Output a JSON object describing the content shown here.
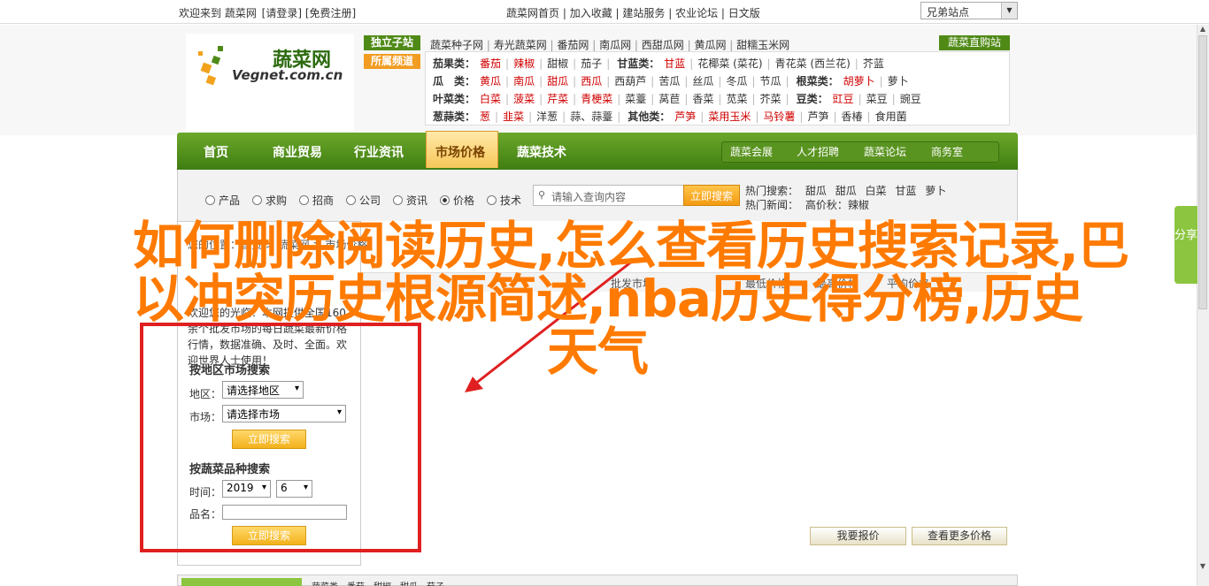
{
  "topbar": {
    "welcome": "欢迎来到 蔬菜网",
    "login": "[请登录]",
    "register": "[免费注册]",
    "links": [
      "蔬菜网首页",
      "加入收藏",
      "建站服务",
      "农业论坛",
      "日文版"
    ],
    "site_select": "兄弟站点"
  },
  "logo": {
    "cn": "蔬菜网",
    "en": "Vegnet.com.cn"
  },
  "tags": {
    "exclusive": "独立子站",
    "featured": "所属频道"
  },
  "cat_top": [
    "蔬菜种子网",
    "寿光蔬菜网",
    "番茄网",
    "南瓜网",
    "西甜瓜网",
    "黄瓜网",
    "甜糯玉米网"
  ],
  "veg_direct": "蔬菜直购站",
  "categories": [
    {
      "head": "茄果类：",
      "items": [
        {
          "t": "番茄",
          "r": true
        },
        {
          "t": "辣椒",
          "r": true
        },
        {
          "t": "甜椒",
          "r": false
        },
        {
          "t": "茄子",
          "r": false
        }
      ],
      "head2": "甘蓝类：",
      "items2": [
        {
          "t": "甘蓝",
          "r": true
        },
        {
          "t": "花椰菜 (菜花)",
          "r": false
        },
        {
          "t": "青花菜 (西兰花)",
          "r": false
        },
        {
          "t": "芥蓝",
          "r": false
        }
      ]
    },
    {
      "head": "瓜　类：",
      "items": [
        {
          "t": "黄瓜",
          "r": true
        },
        {
          "t": "南瓜",
          "r": true
        },
        {
          "t": "甜瓜",
          "r": true
        },
        {
          "t": "西瓜",
          "r": true
        },
        {
          "t": "西葫芦",
          "r": false
        },
        {
          "t": "苦瓜",
          "r": false
        },
        {
          "t": "丝瓜",
          "r": false
        },
        {
          "t": "冬瓜",
          "r": false
        },
        {
          "t": "节瓜",
          "r": false
        }
      ],
      "head2": "根菜类：",
      "items2": [
        {
          "t": "胡萝卜",
          "r": true
        },
        {
          "t": "萝卜",
          "r": false
        }
      ]
    },
    {
      "head": "叶菜类：",
      "items": [
        {
          "t": "白菜",
          "r": true
        },
        {
          "t": "菠菜",
          "r": true
        },
        {
          "t": "芹菜",
          "r": true
        },
        {
          "t": "青梗菜",
          "r": true
        },
        {
          "t": "菜薹",
          "r": false
        },
        {
          "t": "莴苣",
          "r": false
        },
        {
          "t": "香菜",
          "r": false
        },
        {
          "t": "苋菜",
          "r": false
        },
        {
          "t": "芥菜",
          "r": false
        }
      ],
      "head2": "豆类：",
      "items2": [
        {
          "t": "豇豆",
          "r": true
        },
        {
          "t": "菜豆",
          "r": false
        },
        {
          "t": "豌豆",
          "r": false
        }
      ]
    },
    {
      "head": "葱蒜类：",
      "items": [
        {
          "t": "葱",
          "r": true
        },
        {
          "t": "韭菜",
          "r": true
        },
        {
          "t": "洋葱",
          "r": false
        },
        {
          "t": "蒜、蒜薹",
          "r": false
        }
      ],
      "head2": "其他类：",
      "items2": [
        {
          "t": "芦笋",
          "r": true
        },
        {
          "t": "菜用玉米",
          "r": true
        },
        {
          "t": "马铃薯",
          "r": true
        },
        {
          "t": "芦笋",
          "r": false
        },
        {
          "t": "香椿",
          "r": false
        },
        {
          "t": "食用菌",
          "r": false
        }
      ]
    }
  ],
  "nav": {
    "items": [
      "首页",
      "商业贸易",
      "行业资讯",
      "市场价格",
      "蔬菜技术"
    ],
    "active": "市场价格",
    "right": [
      "蔬菜会展",
      "人才招聘",
      "蔬菜论坛",
      "商务室"
    ]
  },
  "search": {
    "radios": [
      "产品",
      "求购",
      "招商",
      "公司",
      "资讯",
      "价格",
      "技术"
    ],
    "selected": "价格",
    "placeholder": "请输入查询内容",
    "button": "立即搜索",
    "hot_label": "热门搜索：",
    "hot": [
      "甜瓜",
      "甜瓜",
      "白菜",
      "甘蓝",
      "萝卜"
    ],
    "news_label": "热门新闻：",
    "news": "高价秋：辣椒"
  },
  "content": {
    "breadcrumb": "您的位置：首页 > 蔬菜网 > 市场价格",
    "col_heads": [
      "批发市场",
      "最低价格",
      "最高价格",
      "平均价格"
    ],
    "intro": "欢迎您的光临！本网提供全国160余个批发市场的每日蔬菜最新价格行情，数据准确、及时、全面。欢迎世界人士使用！",
    "region_title": "按地区市场搜索",
    "region_label": "地区：",
    "region_value": "请选择地区",
    "market_label": "市场：",
    "market_value": "请选择市场",
    "button1": "立即搜索",
    "variety_title": "按蔬菜品种搜索",
    "time_label": "时间：",
    "year": "2019",
    "month": "6",
    "name_label": "品名：",
    "button2": "立即搜索",
    "report_price": "我要报价",
    "more_prices": "查看更多价格"
  },
  "footer": {
    "text": "蔬菜类　番茄　甜椒　甜瓜　茄子"
  },
  "share": "分享",
  "overlay": {
    "line1": "如何删除阅读历史,怎么查看历史搜索记录,巴",
    "line2": "以冲突历史根源简述,nba历史得分榜,历史",
    "line3": "天气"
  },
  "colors": {
    "green": "#4f8a16",
    "orange": "#ff7a00",
    "red_frame": "#e02020"
  }
}
